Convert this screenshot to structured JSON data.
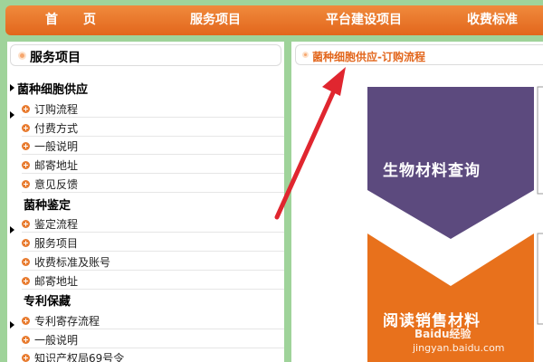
{
  "nav": {
    "items": [
      "首　　页",
      "服务项目",
      "平台建设项目",
      "收费标准"
    ]
  },
  "sidebar": {
    "title": "服务项目",
    "categories": [
      {
        "title": "菌种细胞供应",
        "items": [
          "订购流程",
          "付费方式",
          "一般说明",
          "邮寄地址",
          "意见反馈"
        ]
      },
      {
        "title": "菌种鉴定",
        "items": [
          "鉴定流程",
          "服务项目",
          "收费标准及账号",
          "邮寄地址"
        ]
      },
      {
        "title": "专利保藏",
        "items": [
          "专利寄存流程",
          "一般说明",
          "知识产权局69号令"
        ]
      }
    ]
  },
  "main": {
    "title": "菌种细胞供应-订购流程",
    "steps": [
      "生物材料查询",
      "阅读销售材料"
    ]
  },
  "colors": {
    "nav_orange": "#e8712a",
    "page_green": "#9fd39a",
    "step1_purple": "#5c4a7e",
    "step2_orange": "#e8711c",
    "arrow_red": "#e0262f"
  },
  "watermark": {
    "line1": "Baidu经验",
    "line2": "jingyan.baidu.com"
  }
}
